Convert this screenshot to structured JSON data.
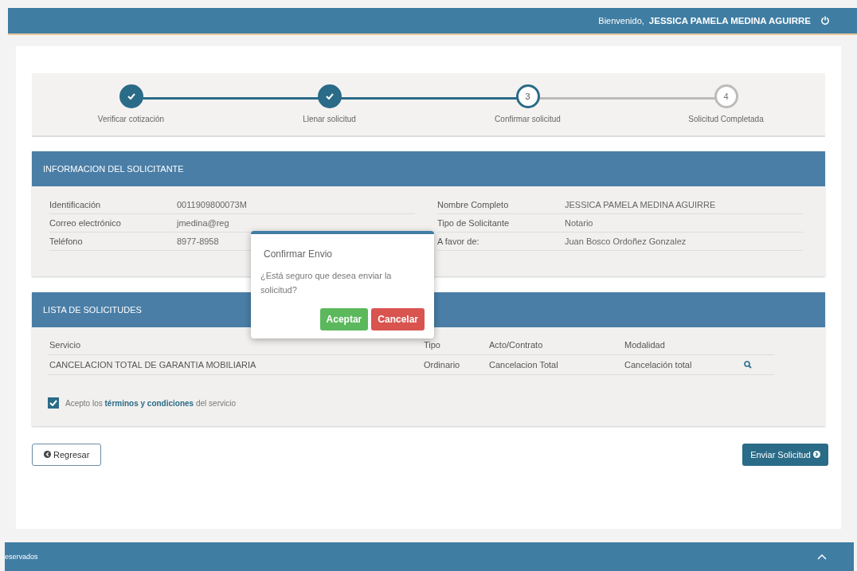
{
  "header": {
    "greeting": "Bienvenido,",
    "user": "JESSICA PAMELA MEDINA AGUIRRE"
  },
  "steps": [
    {
      "label": "Verificar cotización",
      "done": true
    },
    {
      "label": "Llenar solicitud",
      "done": true
    },
    {
      "number": "3",
      "label": "Confirmar solicitud",
      "done": false,
      "current": true
    },
    {
      "number": "4",
      "label": "Solicitud Completada",
      "done": false,
      "current": false
    }
  ],
  "applicant": {
    "title": "INFORMACION DEL SOLICITANTE",
    "fields": [
      {
        "label": "Identificación",
        "value": "0011909800073M"
      },
      {
        "label": "Nombre Completo",
        "value": "JESSICA PAMELA MEDINA AGUIRRE"
      },
      {
        "label": "Correo electrónico",
        "value": "jmedina@reg"
      },
      {
        "label": "Tipo de Solicitante",
        "value": "Notario"
      },
      {
        "label": "Teléfono",
        "value": "8977-8958"
      },
      {
        "label": "A favor de:",
        "value": "Juan Bosco Ordoñez Gonzalez"
      }
    ]
  },
  "requests": {
    "title": "LISTA DE SOLICITUDES",
    "columns": [
      "Servicio",
      "Tipo",
      "Acto/Contrato",
      "Modalidad"
    ],
    "rows": [
      [
        "CANCELACION TOTAL DE GARANTIA MOBILIARIA",
        "Ordinario",
        "Cancelacion Total",
        "Cancelación total"
      ]
    ]
  },
  "terms": {
    "checked": true,
    "before": "Acepto los",
    "link": "términos y condiciones",
    "after": "del servicio"
  },
  "buttons": {
    "back": "Regresar",
    "submit": "Enviar Solicitud"
  },
  "dialog": {
    "title": "Confirmar Envio",
    "message": "¿Está seguro que desea enviar la solicitud?",
    "buttons": [
      {
        "label": "Aceptar",
        "kind": "confirm"
      },
      {
        "label": "Cancelar",
        "kind": "cancel"
      }
    ]
  },
  "footer": {
    "text": "eservados"
  }
}
